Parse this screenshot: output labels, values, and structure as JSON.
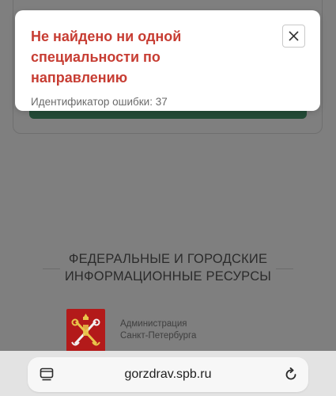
{
  "toast": {
    "title": "Не найдено ни одной специальности по направлению",
    "error_text": "Идентификатор ошибки: 37",
    "close_icon": "close-icon"
  },
  "resources": {
    "title": "ФЕДЕРАЛЬНЫЕ И ГОРОДСКИЕ ИНФОРМАЦИОННЫЕ РЕСУРСЫ",
    "items": [
      {
        "line1": "Администрация",
        "line2": "Санкт-Петербурга",
        "icon": "spb-coat-of-arms-icon"
      }
    ]
  },
  "browser": {
    "url": "gorzdrav.spb.ru",
    "tabs_icon": "tab-overview-icon",
    "reload_icon": "reload-icon"
  },
  "colors": {
    "toast_title": "#c73d33",
    "overlay": "#7f7f7f",
    "primary_button": "#234b37",
    "coat_red": "#b31a1a"
  }
}
